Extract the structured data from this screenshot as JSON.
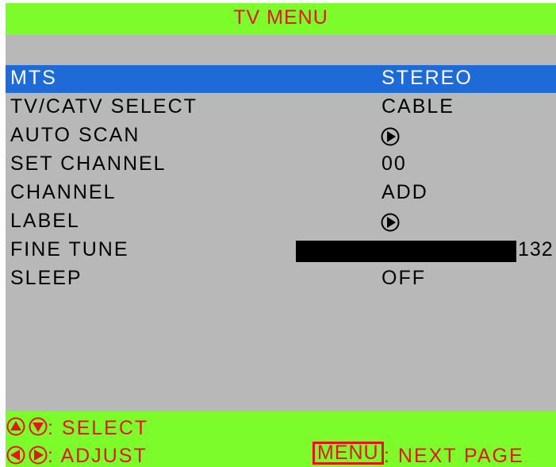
{
  "title": "TV MENU",
  "items": [
    {
      "label": "MTS",
      "value": "STEREO",
      "kind": "text",
      "selected": true
    },
    {
      "label": "TV/CATV SELECT",
      "value": "CABLE",
      "kind": "text",
      "selected": false
    },
    {
      "label": "AUTO SCAN",
      "value": null,
      "kind": "arrow",
      "icon": "play-circle-icon",
      "selected": false
    },
    {
      "label": "SET CHANNEL",
      "value": "00",
      "kind": "text",
      "selected": false
    },
    {
      "label": "CHANNEL",
      "value": "ADD",
      "kind": "text",
      "selected": false
    },
    {
      "label": "LABEL",
      "value": null,
      "kind": "arrow",
      "icon": "play-circle-icon",
      "selected": false
    },
    {
      "label": "FINE TUNE",
      "value": "132",
      "kind": "bar",
      "level": 1.0,
      "selected": false
    },
    {
      "label": "SLEEP",
      "value": "OFF",
      "kind": "text",
      "selected": false
    }
  ],
  "footer": {
    "select_hint": ": SELECT",
    "adjust_hint": ": ADJUST",
    "menu_key": "MENU",
    "next_page_hint": ": NEXT PAGE",
    "select_icons": [
      "up-arrow-circle-icon",
      "down-arrow-circle-icon"
    ],
    "adjust_icons": [
      "left-arrow-circle-icon",
      "right-arrow-circle-icon"
    ]
  },
  "colors": {
    "screen_bg": "#b8b8b8",
    "banner": "#7dfc2c",
    "accent_text": "#e8141c",
    "highlight": "#1e6bd8",
    "highlight_text": "#ffffff",
    "text": "#000000"
  }
}
